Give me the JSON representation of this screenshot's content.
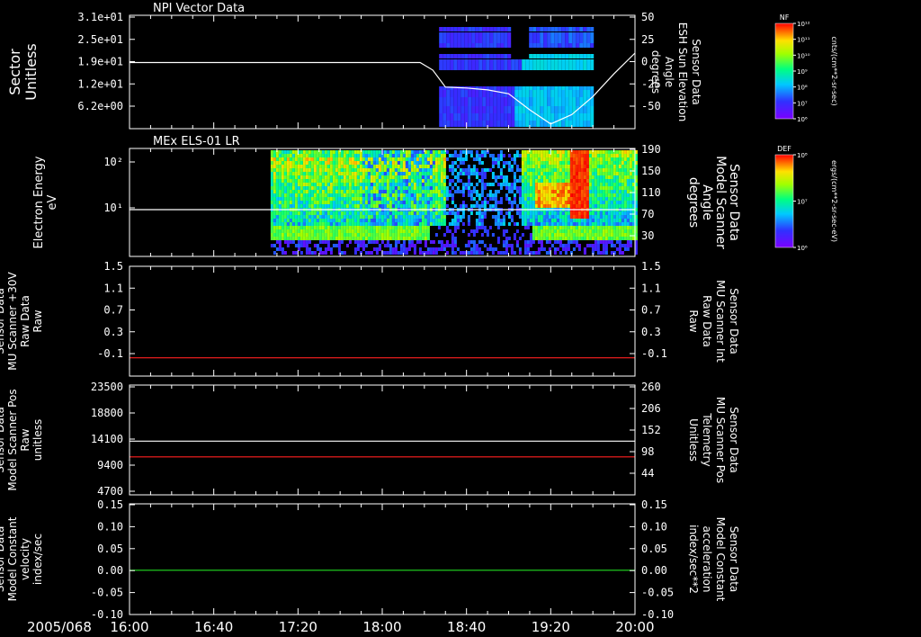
{
  "date_label": "2005/068",
  "time_ticks": [
    "16:00",
    "16:40",
    "17:20",
    "18:00",
    "18:40",
    "19:20",
    "20:00"
  ],
  "colors": {
    "white": "#ffffff",
    "red": "#ff2020",
    "green": "#22dd22",
    "frame": "#ffffff",
    "background": "#000000"
  },
  "panels": [
    {
      "title": "NPI Vector Data",
      "left_label": [
        "Sector",
        "Unitless"
      ],
      "left_ticks": [
        "3.1e+01",
        "2.5e+01",
        "1.9e+01",
        "1.2e+01",
        "6.2e+00"
      ],
      "right_label": [
        "Sensor Data",
        "ESH Sun Elevation",
        "Angle",
        "degrees"
      ],
      "right_ticks": [
        "50",
        "25",
        "0",
        "-25",
        "-50"
      ],
      "colorbar": {
        "label": "NF",
        "unit": "cnts/(cm**2-sr-sec)",
        "ticks": [
          "10¹²",
          "10¹¹",
          "10¹⁰",
          "10⁹",
          "10⁸",
          "10⁷",
          "10⁶"
        ]
      }
    },
    {
      "title": "MEx ELS-01 LR",
      "left_label": [
        "Electron Energy",
        "eV"
      ],
      "left_ticks": [
        "10²",
        "10¹"
      ],
      "right_label": [
        "Sensor Data",
        "Model Scanner",
        "Angle",
        "degrees"
      ],
      "right_ticks": [
        "190",
        "150",
        "110",
        "70",
        "30"
      ],
      "colorbar": {
        "label": "DEF",
        "unit": "ergs/(cm**2-sr-sec-eV)",
        "ticks": [
          "10⁸",
          "10⁷",
          "10⁶"
        ]
      }
    },
    {
      "left_label": [
        "Sensor Data",
        "MU Scanner +30V",
        "Raw Data",
        "Raw"
      ],
      "left_ticks": [
        "1.5",
        "1.1",
        "0.7",
        "0.3",
        "-0.1"
      ],
      "right_label": [
        "Sensor Data",
        "MU Scanner Int",
        "Raw Data",
        "Raw"
      ],
      "right_ticks": [
        "1.5",
        "1.1",
        "0.7",
        "0.3",
        "-0.1"
      ]
    },
    {
      "left_label": [
        "Sensor Data",
        "Model Scanner Pos",
        "Raw",
        "unitless"
      ],
      "left_ticks": [
        "23500",
        "18800",
        "14100",
        "9400",
        "4700"
      ],
      "right_label": [
        "Sensor Data",
        "MU Scanner Pos",
        "Telemetry",
        "Unitless"
      ],
      "right_ticks": [
        "260",
        "206",
        "152",
        "98",
        "44"
      ]
    },
    {
      "left_label": [
        "Sensor Data",
        "Model Constant",
        "velocity",
        "index/sec"
      ],
      "left_ticks": [
        "0.15",
        "0.10",
        "0.05",
        "0.00",
        "-0.05",
        "-0.10"
      ],
      "right_label": [
        "Sensor Data",
        "Model Constant",
        "acceleration",
        "index/sec**2"
      ],
      "right_ticks": [
        "0.15",
        "0.10",
        "0.05",
        "0.00",
        "-0.05",
        "-0.10"
      ]
    }
  ],
  "chart_data": [
    {
      "type": "heatmap",
      "title": "NPI Vector Data",
      "x_range": [
        "16:00",
        "20:00"
      ],
      "ylabel": "Sector Unitless",
      "y_ticks": [
        31,
        25,
        19,
        12,
        6.2
      ],
      "y2label": "Sensor Data ESH Sun Elevation Angle degrees",
      "y2lim": [
        -70,
        50
      ],
      "data_coverage": [
        "18:27",
        "19:40"
      ],
      "series": [
        {
          "name": "ESH Sun Elevation Angle",
          "axis": "right",
          "color": "#ffffff",
          "x": [
            "16:00",
            "17:00",
            "18:00",
            "18:18",
            "18:24",
            "18:30",
            "18:40",
            "18:50",
            "19:00",
            "19:10",
            "19:20",
            "19:30",
            "19:40",
            "19:50",
            "20:00"
          ],
          "y": [
            0,
            0,
            0,
            0,
            -8,
            -26,
            -27,
            -29,
            -33,
            -50,
            -65,
            -55,
            -36,
            -12,
            10
          ]
        }
      ]
    },
    {
      "type": "heatmap",
      "title": "MEx ELS-01 LR",
      "x_range": [
        "16:00",
        "20:00"
      ],
      "ylabel": "Electron Energy eV",
      "yscale": "log",
      "y_ticks": [
        100,
        10
      ],
      "y2label": "Sensor Data Model Scanner Angle degrees",
      "y2lim": [
        10,
        190
      ],
      "data_coverage": [
        "17:07",
        "20:00"
      ],
      "series": [
        {
          "name": "Model Scanner Angle",
          "axis": "right",
          "color": "#ffffff",
          "x": [
            "16:00",
            "20:00"
          ],
          "y": [
            88,
            88
          ]
        }
      ]
    },
    {
      "type": "line",
      "x_range": [
        "16:00",
        "20:00"
      ],
      "ylim": [
        -0.3,
        1.5
      ],
      "series": [
        {
          "name": "MU Scanner Int Raw Data",
          "axis": "right",
          "color": "#ff2020",
          "x": [
            "16:00",
            "20:00"
          ],
          "y": [
            0,
            0
          ]
        }
      ]
    },
    {
      "type": "line",
      "x_range": [
        "16:00",
        "20:00"
      ],
      "ylim": [
        0,
        23500
      ],
      "y2lim": [
        0,
        260
      ],
      "series": [
        {
          "name": "Model Scanner Pos Raw",
          "axis": "left",
          "color": "#ffffff",
          "x": [
            "16:00",
            "20:00"
          ],
          "y": [
            11500,
            11500
          ]
        },
        {
          "name": "MU Scanner Pos Telemetry",
          "axis": "right",
          "color": "#ff2020",
          "x": [
            "16:00",
            "20:00"
          ],
          "y": [
            90,
            90
          ]
        }
      ]
    },
    {
      "type": "line",
      "x_range": [
        "16:00",
        "20:00"
      ],
      "ylim": [
        -0.1,
        0.15
      ],
      "series": [
        {
          "name": "Model Constant acceleration",
          "axis": "right",
          "color": "#22dd22",
          "x": [
            "16:00",
            "20:00"
          ],
          "y": [
            0,
            0
          ]
        }
      ]
    }
  ]
}
